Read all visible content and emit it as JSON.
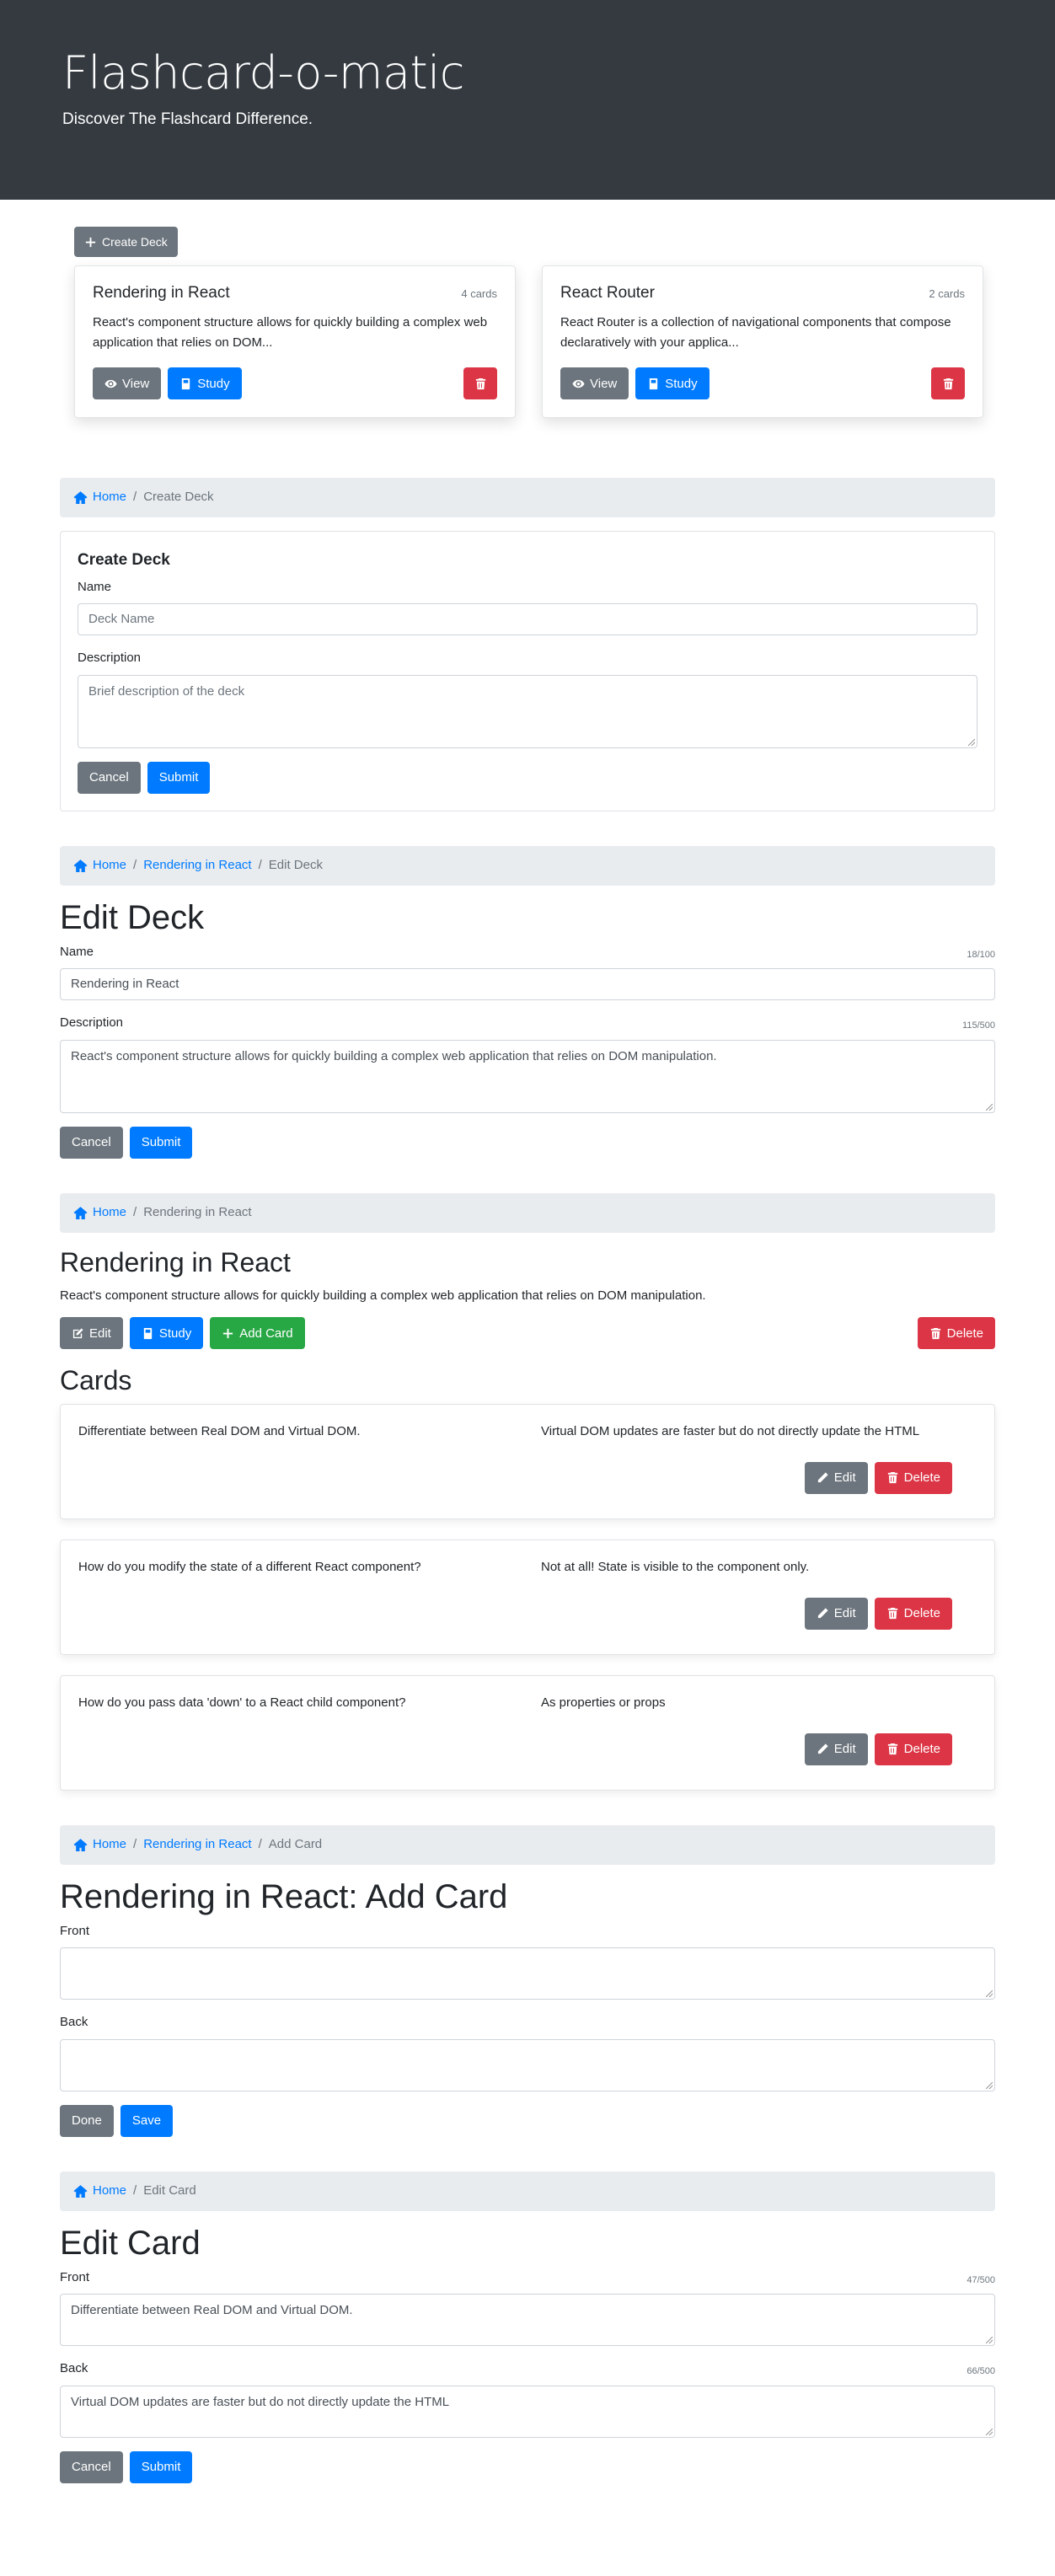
{
  "header": {
    "title": "Flashcard-o-matic",
    "subtitle": "Discover The Flashcard Difference."
  },
  "deck_list": {
    "create_label": "Create Deck",
    "decks": [
      {
        "name": "Rendering in React",
        "count": "4 cards",
        "description": "React's component structure allows for quickly building a complex web application that relies on DOM...",
        "view_label": "View",
        "study_label": "Study"
      },
      {
        "name": "React Router",
        "count": "2 cards",
        "description": "React Router is a collection of navigational components that compose declaratively with your applica...",
        "view_label": "View",
        "study_label": "Study"
      }
    ]
  },
  "create_deck": {
    "breadcrumb": {
      "home": "Home",
      "current": "Create Deck"
    },
    "title": "Create Deck",
    "name_label": "Name",
    "name_placeholder": "Deck Name",
    "description_label": "Description",
    "description_placeholder": "Brief description of the deck",
    "cancel_label": "Cancel",
    "submit_label": "Submit"
  },
  "edit_deck": {
    "breadcrumb": {
      "home": "Home",
      "deck": "Rendering in React",
      "current": "Edit Deck"
    },
    "title": "Edit Deck",
    "name_label": "Name",
    "name_counter": "18/100",
    "name_value": "Rendering in React",
    "description_label": "Description",
    "description_counter": "115/500",
    "description_value": "React's component structure allows for quickly building a complex web application that relies on DOM manipulation.",
    "cancel_label": "Cancel",
    "submit_label": "Submit"
  },
  "deck_view": {
    "breadcrumb": {
      "home": "Home",
      "current": "Rendering in React"
    },
    "title": "Rendering in React",
    "description": "React's component structure allows for quickly building a complex web application that relies on DOM manipulation.",
    "edit_label": "Edit",
    "study_label": "Study",
    "add_card_label": "Add Card",
    "delete_label": "Delete",
    "cards_heading": "Cards",
    "cards": [
      {
        "front": "Differentiate between Real DOM and Virtual DOM.",
        "back": "Virtual DOM updates are faster but do not directly update the HTML",
        "edit_label": "Edit",
        "delete_label": "Delete"
      },
      {
        "front": "How do you modify the state of a different React component?",
        "back": "Not at all! State is visible to the component only.",
        "edit_label": "Edit",
        "delete_label": "Delete"
      },
      {
        "front": "How do you pass data 'down' to a React child component?",
        "back": "As properties or props",
        "edit_label": "Edit",
        "delete_label": "Delete"
      }
    ]
  },
  "add_card": {
    "breadcrumb": {
      "home": "Home",
      "deck": "Rendering in React",
      "current": "Add Card"
    },
    "title": "Rendering in React: Add Card",
    "front_label": "Front",
    "back_label": "Back",
    "done_label": "Done",
    "save_label": "Save"
  },
  "edit_card": {
    "breadcrumb": {
      "home": "Home",
      "current": "Edit Card"
    },
    "title": "Edit Card",
    "front_label": "Front",
    "front_counter": "47/500",
    "front_value": "Differentiate between Real DOM and Virtual DOM.",
    "back_label": "Back",
    "back_counter": "66/500",
    "back_value": "Virtual DOM updates are faster but do not directly update the HTML",
    "cancel_label": "Cancel",
    "submit_label": "Submit"
  },
  "colors": {
    "header_bg": "#343a40",
    "primary": "#007bff",
    "secondary": "#6c757d",
    "danger": "#dc3545",
    "success": "#28a745",
    "breadcrumb_bg": "#e9ecef"
  }
}
